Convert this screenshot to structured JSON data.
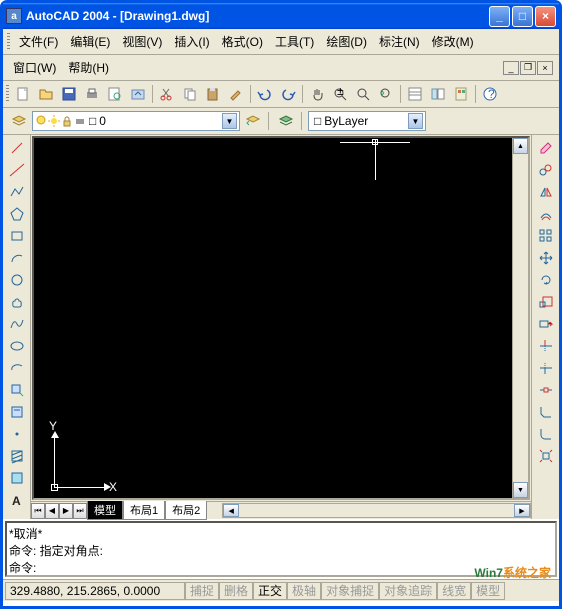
{
  "title": "AutoCAD 2004 - [Drawing1.dwg]",
  "appicon": "a",
  "menus": {
    "file": "文件(F)",
    "edit": "编辑(E)",
    "view": "视图(V)",
    "insert": "插入(I)",
    "format": "格式(O)",
    "tools": "工具(T)",
    "draw": "绘图(D)",
    "dimension": "标注(N)",
    "modify": "修改(M)",
    "window": "窗口(W)",
    "help": "帮助(H)"
  },
  "layer": {
    "current": "0",
    "linetype": "ByLayer",
    "square": "□"
  },
  "tabs": {
    "model": "模型",
    "layout1": "布局1",
    "layout2": "布局2"
  },
  "ucs": {
    "x": "X",
    "y": "Y"
  },
  "cmd": {
    "l1": "*取消*",
    "l2": "命令: 指定对角点:",
    "l3": "命令:"
  },
  "status": {
    "coords": "329.4880, 215.2865, 0.0000",
    "snap": "捕捉",
    "grid": "删格",
    "ortho": "正交",
    "polar": "极轴",
    "osnap": "对象捕捉",
    "otrack": "对象追踪",
    "lwt": "线宽",
    "model": "模型"
  },
  "watermark": {
    "a": "Win7",
    "b": "系统之家"
  }
}
